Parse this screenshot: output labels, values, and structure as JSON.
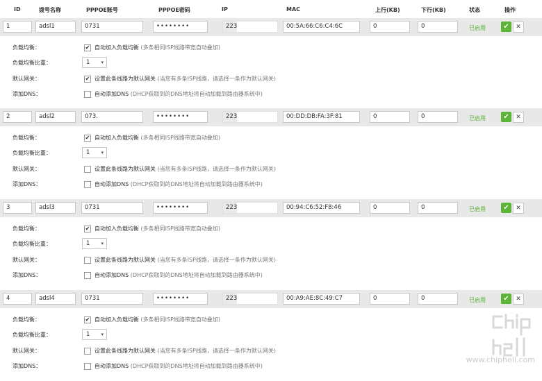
{
  "header": {
    "columns": [
      "ID",
      "拨号名称",
      "PPPOE账号",
      "PPPOE密码",
      "IP",
      "MAC",
      "上行(KB)",
      "下行(KB)",
      "状态",
      "操作"
    ]
  },
  "labels": {
    "load_balance": "负载均衡：",
    "balance_ratio": "负载均衡比重：",
    "default_gateway": "默认网关：",
    "add_dns": "添加DNS：",
    "load_balance_text": "自动加入负载均衡",
    "load_balance_note": "(多条相同ISP线路带宽自动叠加)",
    "gateway_text": "设置此条线路为默认网关",
    "gateway_note": "(当您有多条ISP线路，请选择一条作为默认网关)",
    "dns_text": "自动添加DNS",
    "dns_note": "(DHCP获取到的DNS地址将自动加载到路由器系统中)",
    "ok_icon": "✔",
    "delete_icon": "✕",
    "checked_glyph": "✔"
  },
  "lines": [
    {
      "id": "1",
      "name": "adsl1",
      "account": "0731",
      "password": "••••••••",
      "ip": "223",
      "mac": "00:5A:66:C6:C4:6C",
      "up": "0",
      "down": "0",
      "status": "已启用",
      "ratio": "1",
      "load_balance": true,
      "default_gateway": true,
      "add_dns": false
    },
    {
      "id": "2",
      "name": "adsl2",
      "account": "073.",
      "password": "••••••••",
      "ip": "223",
      "mac": "00:DD:DB:FA:3F:81",
      "up": "0",
      "down": "0",
      "status": "已启用",
      "ratio": "1",
      "load_balance": true,
      "default_gateway": false,
      "add_dns": false
    },
    {
      "id": "3",
      "name": "adsl3",
      "account": "0731",
      "password": "••••••••",
      "ip": "223.",
      "mac": "00:94:C6:52:F8:46",
      "up": "0",
      "down": "0",
      "status": "已启用",
      "ratio": "1",
      "load_balance": true,
      "default_gateway": false,
      "add_dns": false
    },
    {
      "id": "4",
      "name": "adsl4",
      "account": "0731",
      "password": "••••••••",
      "ip": "223.",
      "mac": "00:A9:AE:8C:49:C7",
      "up": "0",
      "down": "0",
      "status": "已启用",
      "ratio": "1",
      "load_balance": true,
      "default_gateway": false,
      "add_dns": false
    }
  ],
  "watermark": {
    "text": "www.chiphell.com"
  }
}
